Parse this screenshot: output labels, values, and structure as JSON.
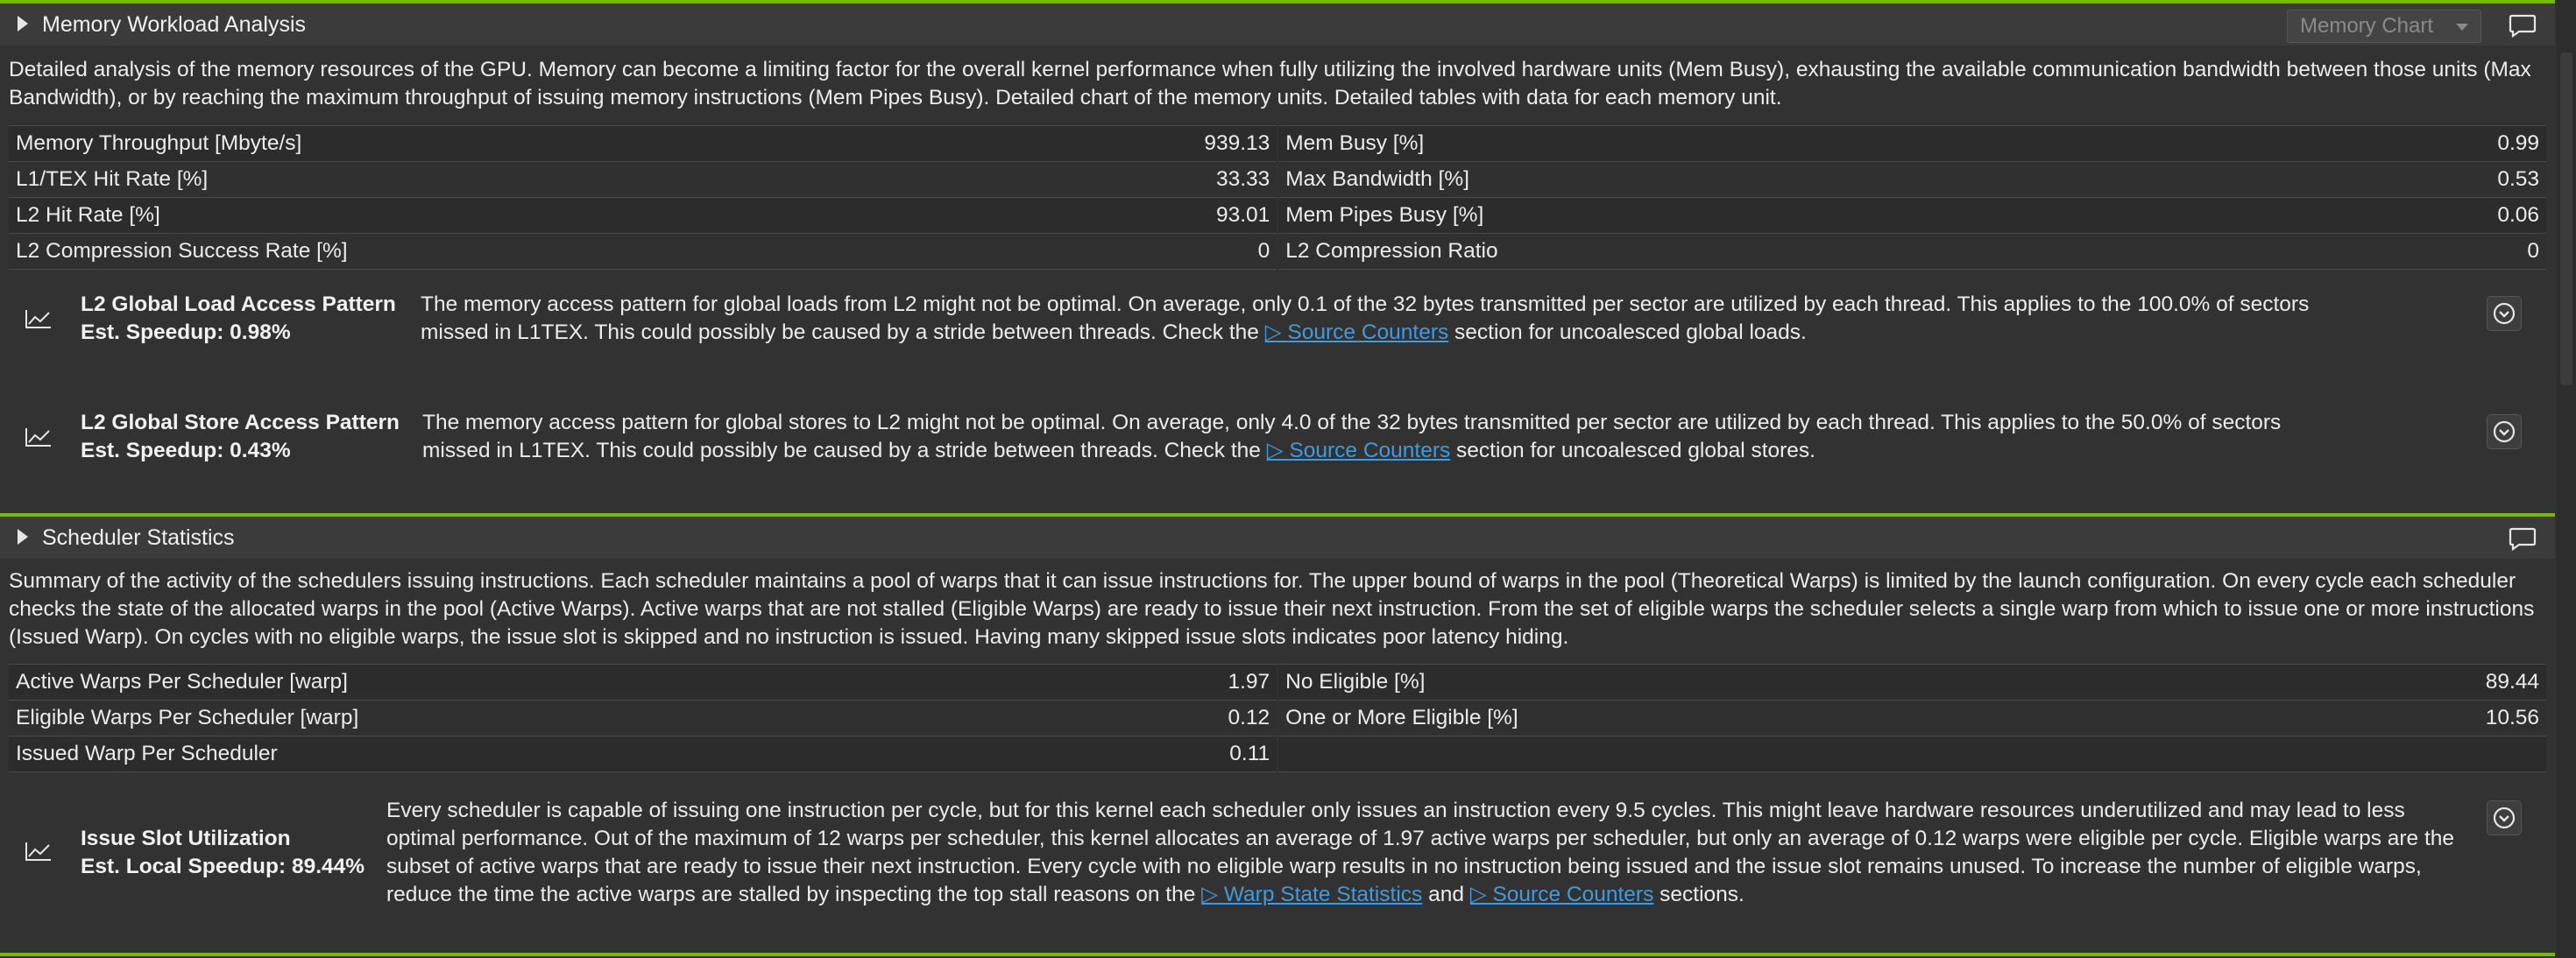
{
  "memory": {
    "title": "Memory Workload Analysis",
    "chart_select": "Memory Chart",
    "description": "Detailed analysis of the memory resources of the GPU. Memory can become a limiting factor for the overall kernel performance when fully utilizing the involved hardware units (Mem Busy), exhausting the available communication bandwidth between those units (Max Bandwidth), or by reaching the maximum throughput of issuing memory instructions (Mem Pipes Busy). Detailed chart of the memory units. Detailed tables with data for each memory unit.",
    "metrics": [
      {
        "ln": "Memory Throughput [Mbyte/s]",
        "lv": "939.13",
        "rn": "Mem Busy [%]",
        "rv": "0.99"
      },
      {
        "ln": "L1/TEX Hit Rate [%]",
        "lv": "33.33",
        "rn": "Max Bandwidth [%]",
        "rv": "0.53"
      },
      {
        "ln": "L2 Hit Rate [%]",
        "lv": "93.01",
        "rn": "Mem Pipes Busy [%]",
        "rv": "0.06"
      },
      {
        "ln": "L2 Compression Success Rate [%]",
        "lv": "0",
        "rn": "L2 Compression Ratio",
        "rv": "0"
      }
    ],
    "rules": [
      {
        "title": "L2 Global Load Access Pattern",
        "speedup": "Est. Speedup: 0.98%",
        "text1": "The memory access pattern for global loads from L2 might not be optimal. On average, only 0.1 of the 32 bytes transmitted per sector are utilized by each thread. This applies to the 100.0% of sectors",
        "text2a": "missed in L1TEX. This could possibly be caused by a stride between threads. Check the ",
        "link": "Source Counters",
        "text2b": " section for uncoalesced global loads."
      },
      {
        "title": "L2 Global Store Access Pattern",
        "speedup": "Est. Speedup: 0.43%",
        "text1": "The memory access pattern for global stores to L2 might not be optimal. On average, only 4.0 of the 32 bytes transmitted per sector are utilized by each thread. This applies to the 50.0% of sectors",
        "text2a": "missed in L1TEX. This could possibly be caused by a stride between threads. Check the ",
        "link": "Source Counters",
        "text2b": " section for uncoalesced global stores."
      }
    ]
  },
  "scheduler": {
    "title": "Scheduler Statistics",
    "description": "Summary of the activity of the schedulers issuing instructions. Each scheduler maintains a pool of warps that it can issue instructions for. The upper bound of warps in the pool (Theoretical Warps) is limited by the launch configuration. On every cycle each scheduler checks the state of the allocated warps in the pool (Active Warps). Active warps that are not stalled (Eligible Warps) are ready to issue their next instruction. From the set of eligible warps the scheduler selects a single warp from which to issue one or more instructions (Issued Warp). On cycles with no eligible warps, the issue slot is skipped and no instruction is issued. Having many skipped issue slots indicates poor latency hiding.",
    "metrics": [
      {
        "ln": "Active Warps Per Scheduler [warp]",
        "lv": "1.97",
        "rn": "No Eligible [%]",
        "rv": "89.44"
      },
      {
        "ln": "Eligible Warps Per Scheduler [warp]",
        "lv": "0.12",
        "rn": "One or More Eligible [%]",
        "rv": "10.56"
      },
      {
        "ln": "Issued Warp Per Scheduler",
        "lv": "0.11",
        "rn": "",
        "rv": ""
      }
    ],
    "rule": {
      "title": "Issue Slot Utilization",
      "speedup": "Est. Local Speedup: 89.44%",
      "text": "Every scheduler is capable of issuing one instruction per cycle, but for this kernel each scheduler only issues an instruction every 9.5 cycles. This might leave hardware resources underutilized and may lead to less optimal performance. Out of the maximum of 12 warps per scheduler, this kernel allocates an average of 1.97 active warps per scheduler, but only an average of 0.12 warps were eligible per cycle. Eligible warps are the subset of active warps that are ready to issue their next instruction. Every cycle with no eligible warp results in no instruction being issued and the issue slot remains unused. To increase the number of eligible warps, reduce the time the active warps are stalled by inspecting the top stall reasons on the ",
      "link1": "Warp State Statistics",
      "and": " and ",
      "link2": "Source Counters",
      "end": " sections."
    }
  }
}
